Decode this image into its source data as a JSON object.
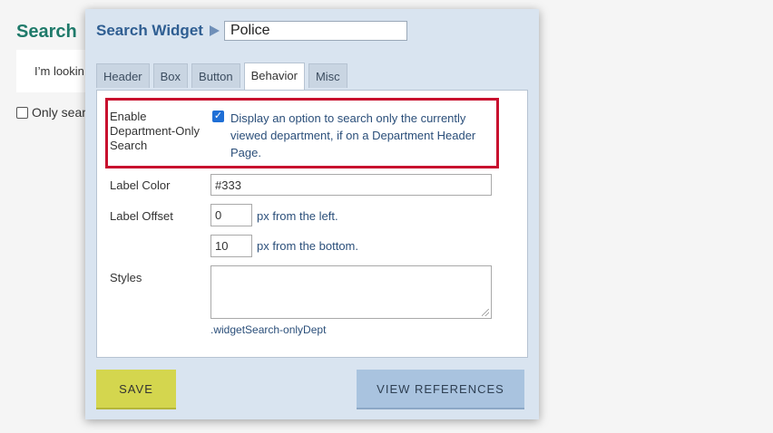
{
  "background": {
    "title": "Search",
    "card_text": "I’m lookin",
    "checkbox_label": "Only sear"
  },
  "dialog": {
    "title": "Search Widget",
    "name_value": "Police",
    "tabs": [
      {
        "label": "Header"
      },
      {
        "label": "Box"
      },
      {
        "label": "Button"
      },
      {
        "label": "Behavior",
        "active": true
      },
      {
        "label": "Misc"
      }
    ],
    "behavior": {
      "dept_label": "Enable Department-Only Search",
      "dept_checked": true,
      "dept_desc": "Display an option to search only the currently viewed department, if on a Department Header Page.",
      "label_color_label": "Label Color",
      "label_color_value": "#333",
      "label_offset_label": "Label Offset",
      "offset_left_value": "0",
      "offset_left_suffix": "px from the left.",
      "offset_bottom_value": "10",
      "offset_bottom_suffix": "px from the bottom.",
      "styles_label": "Styles",
      "styles_value": "",
      "styles_hint": ".widgetSearch-onlyDept"
    },
    "buttons": {
      "save": "SAVE",
      "view_references": "VIEW REFERENCES"
    }
  },
  "colors": {
    "highlight": "#c8102e",
    "save_button": "#d4d64e",
    "refs_button": "#a9c3df",
    "dialog_bg": "#d9e4f0"
  }
}
